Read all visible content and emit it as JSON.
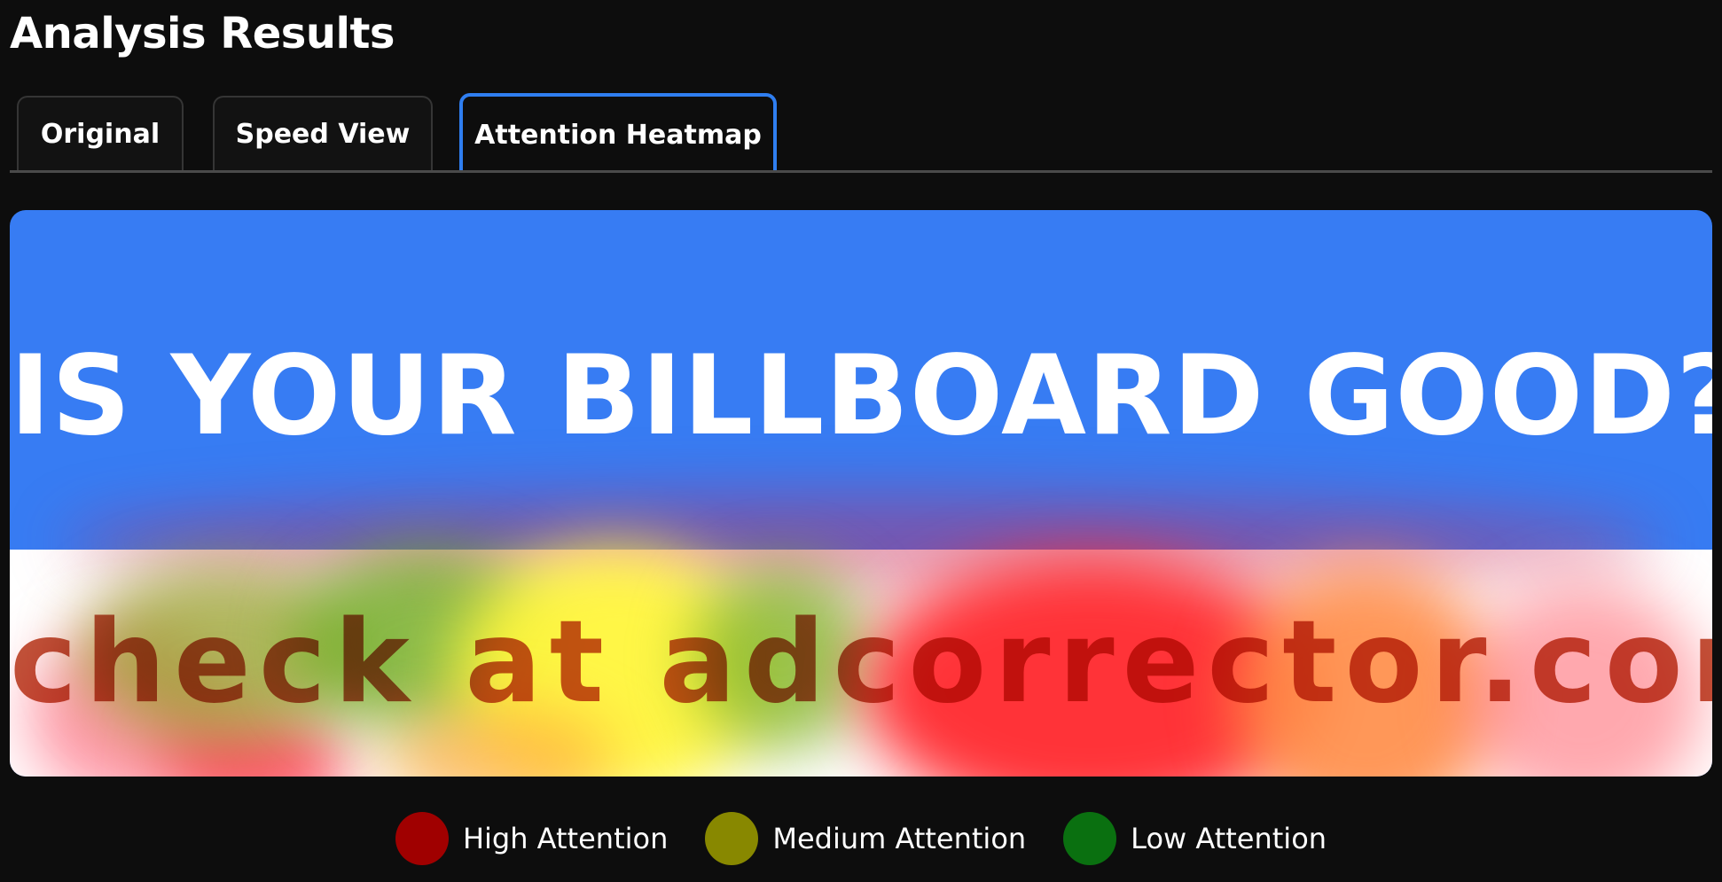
{
  "page": {
    "title": "Analysis Results"
  },
  "tabs": [
    {
      "label": "Original",
      "active": false
    },
    {
      "label": "Speed View",
      "active": false
    },
    {
      "label": "Attention Heatmap",
      "active": true
    }
  ],
  "billboard": {
    "headline": "IS YOUR BILLBOARD GOOD?",
    "subline": "check at adcorrector.com",
    "background_top_color": "#377cf3",
    "background_bottom_color": "#ffffff"
  },
  "legend": [
    {
      "label": "High Attention",
      "color": "#a00000"
    },
    {
      "label": "Medium Attention",
      "color": "#888800"
    },
    {
      "label": "Low Attention",
      "color": "#0a7010"
    }
  ],
  "colors": {
    "accent": "#2f7ef0",
    "page_background": "#0d0d0d"
  }
}
